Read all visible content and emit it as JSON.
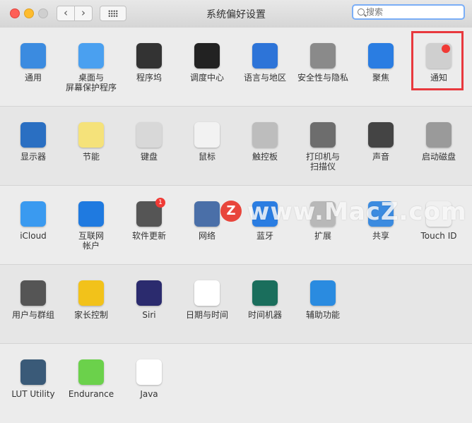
{
  "window": {
    "title": "系统偏好设置"
  },
  "search": {
    "placeholder": "搜索"
  },
  "rows": [
    [
      {
        "name": "通用",
        "icon": "general-icon",
        "color": "#3b8be0"
      },
      {
        "name": "桌面与\n屏幕保护程序",
        "icon": "desktop-screensaver-icon",
        "color": "#4aa0f0"
      },
      {
        "name": "程序坞",
        "icon": "dock-icon",
        "color": "#333333"
      },
      {
        "name": "调度中心",
        "icon": "mission-control-icon",
        "color": "#222222"
      },
      {
        "name": "语言与地区",
        "icon": "language-region-icon",
        "color": "#2d74d8"
      },
      {
        "name": "安全性与隐私",
        "icon": "security-privacy-icon",
        "color": "#8a8a8a"
      },
      {
        "name": "聚焦",
        "icon": "spotlight-icon",
        "color": "#2a7de2"
      },
      {
        "name": "通知",
        "icon": "notifications-icon",
        "color": "#cfcfcf"
      }
    ],
    [
      {
        "name": "显示器",
        "icon": "displays-icon",
        "color": "#2a6fc2"
      },
      {
        "name": "节能",
        "icon": "energy-saver-icon",
        "color": "#f5e27a"
      },
      {
        "name": "键盘",
        "icon": "keyboard-icon",
        "color": "#d8d8d8"
      },
      {
        "name": "鼠标",
        "icon": "mouse-icon",
        "color": "#f2f2f2"
      },
      {
        "name": "触控板",
        "icon": "trackpad-icon",
        "color": "#bdbdbd"
      },
      {
        "name": "打印机与\n扫描仪",
        "icon": "printer-scanner-icon",
        "color": "#6d6d6d"
      },
      {
        "name": "声音",
        "icon": "sound-icon",
        "color": "#444444"
      },
      {
        "name": "启动磁盘",
        "icon": "startup-disk-icon",
        "color": "#9a9a9a"
      }
    ],
    [
      {
        "name": "iCloud",
        "icon": "icloud-icon",
        "color": "#3a9af0"
      },
      {
        "name": "互联网\n帐户",
        "icon": "internet-accounts-icon",
        "color": "#1f7ae0"
      },
      {
        "name": "软件更新",
        "icon": "software-update-icon",
        "color": "#555555",
        "badge": "1"
      },
      {
        "name": "网络",
        "icon": "network-icon",
        "color": "#4a6fa8"
      },
      {
        "name": "蓝牙",
        "icon": "bluetooth-icon",
        "color": "#2a7de2"
      },
      {
        "name": "扩展",
        "icon": "extensions-icon",
        "color": "#b8b8b8"
      },
      {
        "name": "共享",
        "icon": "sharing-icon",
        "color": "#3b8be0"
      },
      {
        "name": "Touch ID",
        "icon": "touch-id-icon",
        "color": "#f0f0f0"
      }
    ],
    [
      {
        "name": "用户与群组",
        "icon": "users-groups-icon",
        "color": "#555555"
      },
      {
        "name": "家长控制",
        "icon": "parental-controls-icon",
        "color": "#f2c21a"
      },
      {
        "name": "Siri",
        "icon": "siri-icon",
        "color": "#2b2b6e"
      },
      {
        "name": "日期与时间",
        "icon": "date-time-icon",
        "color": "#ffffff"
      },
      {
        "name": "时间机器",
        "icon": "time-machine-icon",
        "color": "#1a6e5c"
      },
      {
        "name": "辅助功能",
        "icon": "accessibility-icon",
        "color": "#2a8be0"
      }
    ],
    [
      {
        "name": "LUT Utility",
        "icon": "lut-utility-icon",
        "color": "#3a5a78"
      },
      {
        "name": "Endurance",
        "icon": "endurance-icon",
        "color": "#6bd14b"
      },
      {
        "name": "Java",
        "icon": "java-icon",
        "color": "#ffffff"
      }
    ]
  ],
  "watermark": {
    "text": "www.MacZ.com",
    "badge": "Z"
  }
}
